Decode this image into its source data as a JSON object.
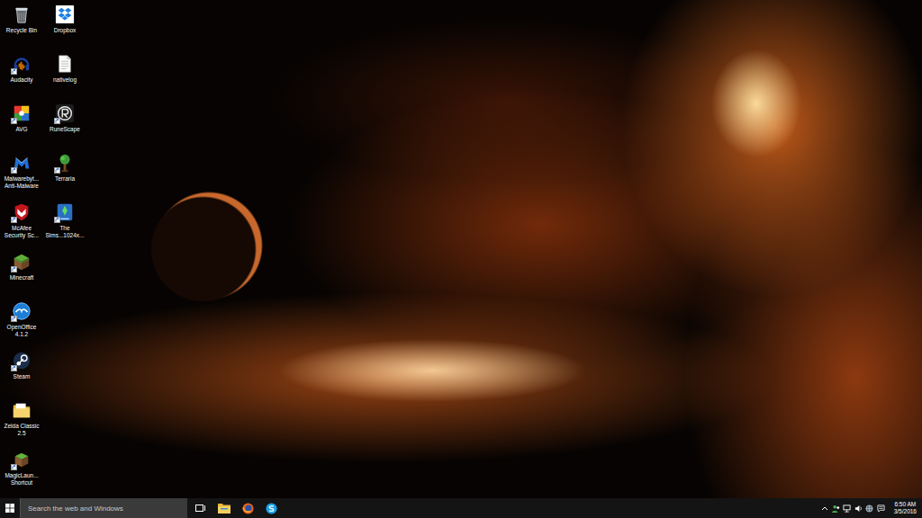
{
  "desktop": {
    "icons": [
      {
        "lines": [
          "Recycle Bin"
        ],
        "shortcut": false
      },
      {
        "lines": [
          "Audacity"
        ],
        "shortcut": true
      },
      {
        "lines": [
          "AVG"
        ],
        "shortcut": true
      },
      {
        "lines": [
          "Malwarebyt...",
          "Anti-Malware"
        ],
        "shortcut": true
      },
      {
        "lines": [
          "McAfee",
          "Security Sc..."
        ],
        "shortcut": true
      },
      {
        "lines": [
          "Minecraft"
        ],
        "shortcut": true
      },
      {
        "lines": [
          "OpenOffice",
          "4.1.2"
        ],
        "shortcut": true
      },
      {
        "lines": [
          "Steam"
        ],
        "shortcut": true
      },
      {
        "lines": [
          "Zelda Classic",
          "2.5"
        ],
        "shortcut": false
      },
      {
        "lines": [
          "MagicLaun...",
          "Shortcut"
        ],
        "shortcut": true
      },
      {
        "lines": [
          "Dropbox"
        ],
        "shortcut": false
      },
      {
        "lines": [
          "nativelog"
        ],
        "shortcut": false
      },
      {
        "lines": [
          "RuneScape"
        ],
        "shortcut": true
      },
      {
        "lines": [
          "Terraria"
        ],
        "shortcut": true
      },
      {
        "lines": [
          "The",
          "Sims...1024x..."
        ],
        "shortcut": true
      }
    ]
  },
  "taskbar": {
    "search": {
      "placeholder": "Search the web and Windows"
    },
    "clock": {
      "time": "6:50 AM",
      "date": "3/5/2016"
    }
  }
}
